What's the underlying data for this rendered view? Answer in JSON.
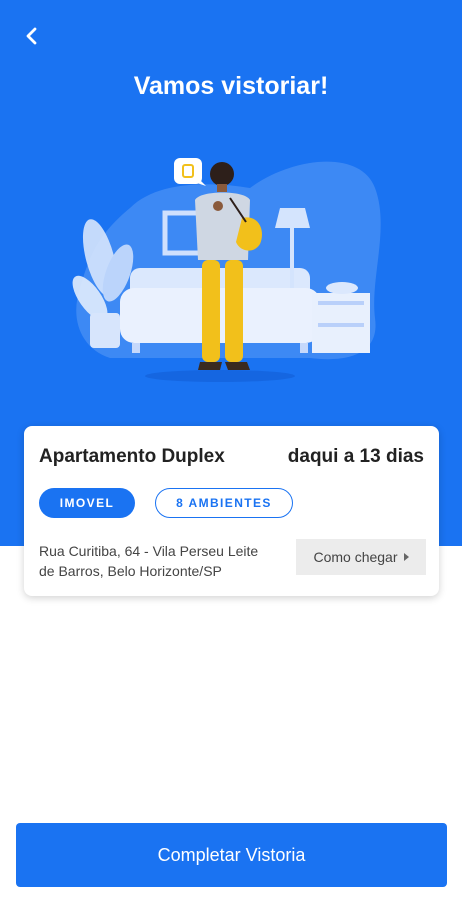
{
  "header": {
    "back_icon": "chevron-left-icon",
    "title": "Vamos vistoriar!"
  },
  "property": {
    "name": "Apartamento Duplex",
    "schedule": "daqui a 13 dias",
    "type_badge": "IMOVEL",
    "rooms_badge": "8 AMBIENTES",
    "address_line1": "Rua Curitiba, 64 - Vila Perseu Leite",
    "address_line2": "de Barros,  Belo Horizonte/SP",
    "directions_label": "Como chegar"
  },
  "actions": {
    "complete_label": "Completar Vistoria"
  },
  "colors": {
    "primary": "#1a73f2",
    "accent_yellow": "#f2c01b"
  }
}
